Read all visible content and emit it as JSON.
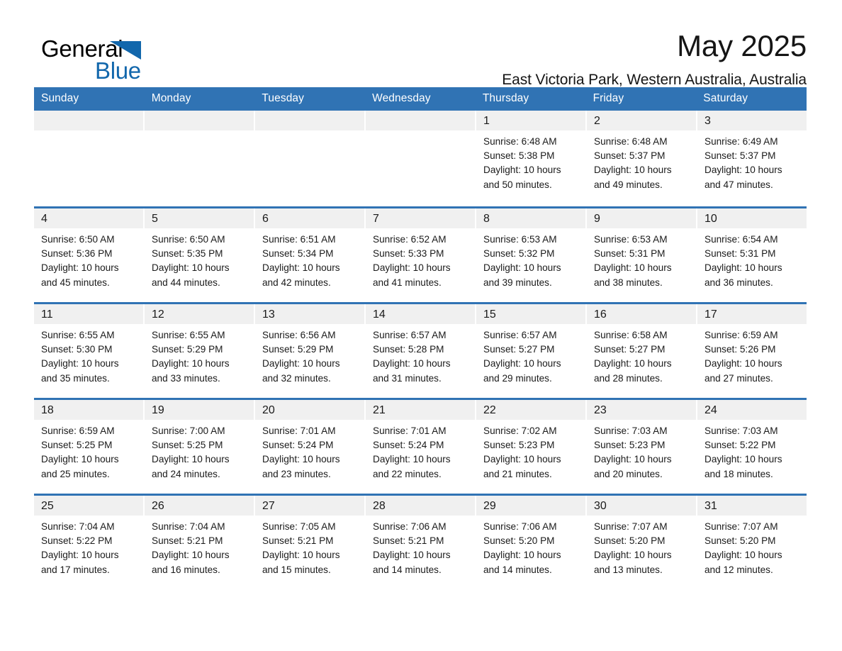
{
  "brand": {
    "name_part1": "General",
    "name_part2": "Blue",
    "accent_color": "#1267ac"
  },
  "header": {
    "title": "May 2025",
    "subtitle": "East Victoria Park, Western Australia, Australia",
    "header_blue": "#3073b4",
    "day_band_gray": "#f0f0f0"
  },
  "weekdays": [
    "Sunday",
    "Monday",
    "Tuesday",
    "Wednesday",
    "Thursday",
    "Friday",
    "Saturday"
  ],
  "weeks": [
    [
      {
        "day": "",
        "sunrise": "",
        "sunset": "",
        "daylight1": "",
        "daylight2": ""
      },
      {
        "day": "",
        "sunrise": "",
        "sunset": "",
        "daylight1": "",
        "daylight2": ""
      },
      {
        "day": "",
        "sunrise": "",
        "sunset": "",
        "daylight1": "",
        "daylight2": ""
      },
      {
        "day": "",
        "sunrise": "",
        "sunset": "",
        "daylight1": "",
        "daylight2": ""
      },
      {
        "day": "1",
        "sunrise": "Sunrise: 6:48 AM",
        "sunset": "Sunset: 5:38 PM",
        "daylight1": "Daylight: 10 hours",
        "daylight2": "and 50 minutes."
      },
      {
        "day": "2",
        "sunrise": "Sunrise: 6:48 AM",
        "sunset": "Sunset: 5:37 PM",
        "daylight1": "Daylight: 10 hours",
        "daylight2": "and 49 minutes."
      },
      {
        "day": "3",
        "sunrise": "Sunrise: 6:49 AM",
        "sunset": "Sunset: 5:37 PM",
        "daylight1": "Daylight: 10 hours",
        "daylight2": "and 47 minutes."
      }
    ],
    [
      {
        "day": "4",
        "sunrise": "Sunrise: 6:50 AM",
        "sunset": "Sunset: 5:36 PM",
        "daylight1": "Daylight: 10 hours",
        "daylight2": "and 45 minutes."
      },
      {
        "day": "5",
        "sunrise": "Sunrise: 6:50 AM",
        "sunset": "Sunset: 5:35 PM",
        "daylight1": "Daylight: 10 hours",
        "daylight2": "and 44 minutes."
      },
      {
        "day": "6",
        "sunrise": "Sunrise: 6:51 AM",
        "sunset": "Sunset: 5:34 PM",
        "daylight1": "Daylight: 10 hours",
        "daylight2": "and 42 minutes."
      },
      {
        "day": "7",
        "sunrise": "Sunrise: 6:52 AM",
        "sunset": "Sunset: 5:33 PM",
        "daylight1": "Daylight: 10 hours",
        "daylight2": "and 41 minutes."
      },
      {
        "day": "8",
        "sunrise": "Sunrise: 6:53 AM",
        "sunset": "Sunset: 5:32 PM",
        "daylight1": "Daylight: 10 hours",
        "daylight2": "and 39 minutes."
      },
      {
        "day": "9",
        "sunrise": "Sunrise: 6:53 AM",
        "sunset": "Sunset: 5:31 PM",
        "daylight1": "Daylight: 10 hours",
        "daylight2": "and 38 minutes."
      },
      {
        "day": "10",
        "sunrise": "Sunrise: 6:54 AM",
        "sunset": "Sunset: 5:31 PM",
        "daylight1": "Daylight: 10 hours",
        "daylight2": "and 36 minutes."
      }
    ],
    [
      {
        "day": "11",
        "sunrise": "Sunrise: 6:55 AM",
        "sunset": "Sunset: 5:30 PM",
        "daylight1": "Daylight: 10 hours",
        "daylight2": "and 35 minutes."
      },
      {
        "day": "12",
        "sunrise": "Sunrise: 6:55 AM",
        "sunset": "Sunset: 5:29 PM",
        "daylight1": "Daylight: 10 hours",
        "daylight2": "and 33 minutes."
      },
      {
        "day": "13",
        "sunrise": "Sunrise: 6:56 AM",
        "sunset": "Sunset: 5:29 PM",
        "daylight1": "Daylight: 10 hours",
        "daylight2": "and 32 minutes."
      },
      {
        "day": "14",
        "sunrise": "Sunrise: 6:57 AM",
        "sunset": "Sunset: 5:28 PM",
        "daylight1": "Daylight: 10 hours",
        "daylight2": "and 31 minutes."
      },
      {
        "day": "15",
        "sunrise": "Sunrise: 6:57 AM",
        "sunset": "Sunset: 5:27 PM",
        "daylight1": "Daylight: 10 hours",
        "daylight2": "and 29 minutes."
      },
      {
        "day": "16",
        "sunrise": "Sunrise: 6:58 AM",
        "sunset": "Sunset: 5:27 PM",
        "daylight1": "Daylight: 10 hours",
        "daylight2": "and 28 minutes."
      },
      {
        "day": "17",
        "sunrise": "Sunrise: 6:59 AM",
        "sunset": "Sunset: 5:26 PM",
        "daylight1": "Daylight: 10 hours",
        "daylight2": "and 27 minutes."
      }
    ],
    [
      {
        "day": "18",
        "sunrise": "Sunrise: 6:59 AM",
        "sunset": "Sunset: 5:25 PM",
        "daylight1": "Daylight: 10 hours",
        "daylight2": "and 25 minutes."
      },
      {
        "day": "19",
        "sunrise": "Sunrise: 7:00 AM",
        "sunset": "Sunset: 5:25 PM",
        "daylight1": "Daylight: 10 hours",
        "daylight2": "and 24 minutes."
      },
      {
        "day": "20",
        "sunrise": "Sunrise: 7:01 AM",
        "sunset": "Sunset: 5:24 PM",
        "daylight1": "Daylight: 10 hours",
        "daylight2": "and 23 minutes."
      },
      {
        "day": "21",
        "sunrise": "Sunrise: 7:01 AM",
        "sunset": "Sunset: 5:24 PM",
        "daylight1": "Daylight: 10 hours",
        "daylight2": "and 22 minutes."
      },
      {
        "day": "22",
        "sunrise": "Sunrise: 7:02 AM",
        "sunset": "Sunset: 5:23 PM",
        "daylight1": "Daylight: 10 hours",
        "daylight2": "and 21 minutes."
      },
      {
        "day": "23",
        "sunrise": "Sunrise: 7:03 AM",
        "sunset": "Sunset: 5:23 PM",
        "daylight1": "Daylight: 10 hours",
        "daylight2": "and 20 minutes."
      },
      {
        "day": "24",
        "sunrise": "Sunrise: 7:03 AM",
        "sunset": "Sunset: 5:22 PM",
        "daylight1": "Daylight: 10 hours",
        "daylight2": "and 18 minutes."
      }
    ],
    [
      {
        "day": "25",
        "sunrise": "Sunrise: 7:04 AM",
        "sunset": "Sunset: 5:22 PM",
        "daylight1": "Daylight: 10 hours",
        "daylight2": "and 17 minutes."
      },
      {
        "day": "26",
        "sunrise": "Sunrise: 7:04 AM",
        "sunset": "Sunset: 5:21 PM",
        "daylight1": "Daylight: 10 hours",
        "daylight2": "and 16 minutes."
      },
      {
        "day": "27",
        "sunrise": "Sunrise: 7:05 AM",
        "sunset": "Sunset: 5:21 PM",
        "daylight1": "Daylight: 10 hours",
        "daylight2": "and 15 minutes."
      },
      {
        "day": "28",
        "sunrise": "Sunrise: 7:06 AM",
        "sunset": "Sunset: 5:21 PM",
        "daylight1": "Daylight: 10 hours",
        "daylight2": "and 14 minutes."
      },
      {
        "day": "29",
        "sunrise": "Sunrise: 7:06 AM",
        "sunset": "Sunset: 5:20 PM",
        "daylight1": "Daylight: 10 hours",
        "daylight2": "and 14 minutes."
      },
      {
        "day": "30",
        "sunrise": "Sunrise: 7:07 AM",
        "sunset": "Sunset: 5:20 PM",
        "daylight1": "Daylight: 10 hours",
        "daylight2": "and 13 minutes."
      },
      {
        "day": "31",
        "sunrise": "Sunrise: 7:07 AM",
        "sunset": "Sunset: 5:20 PM",
        "daylight1": "Daylight: 10 hours",
        "daylight2": "and 12 minutes."
      }
    ]
  ]
}
